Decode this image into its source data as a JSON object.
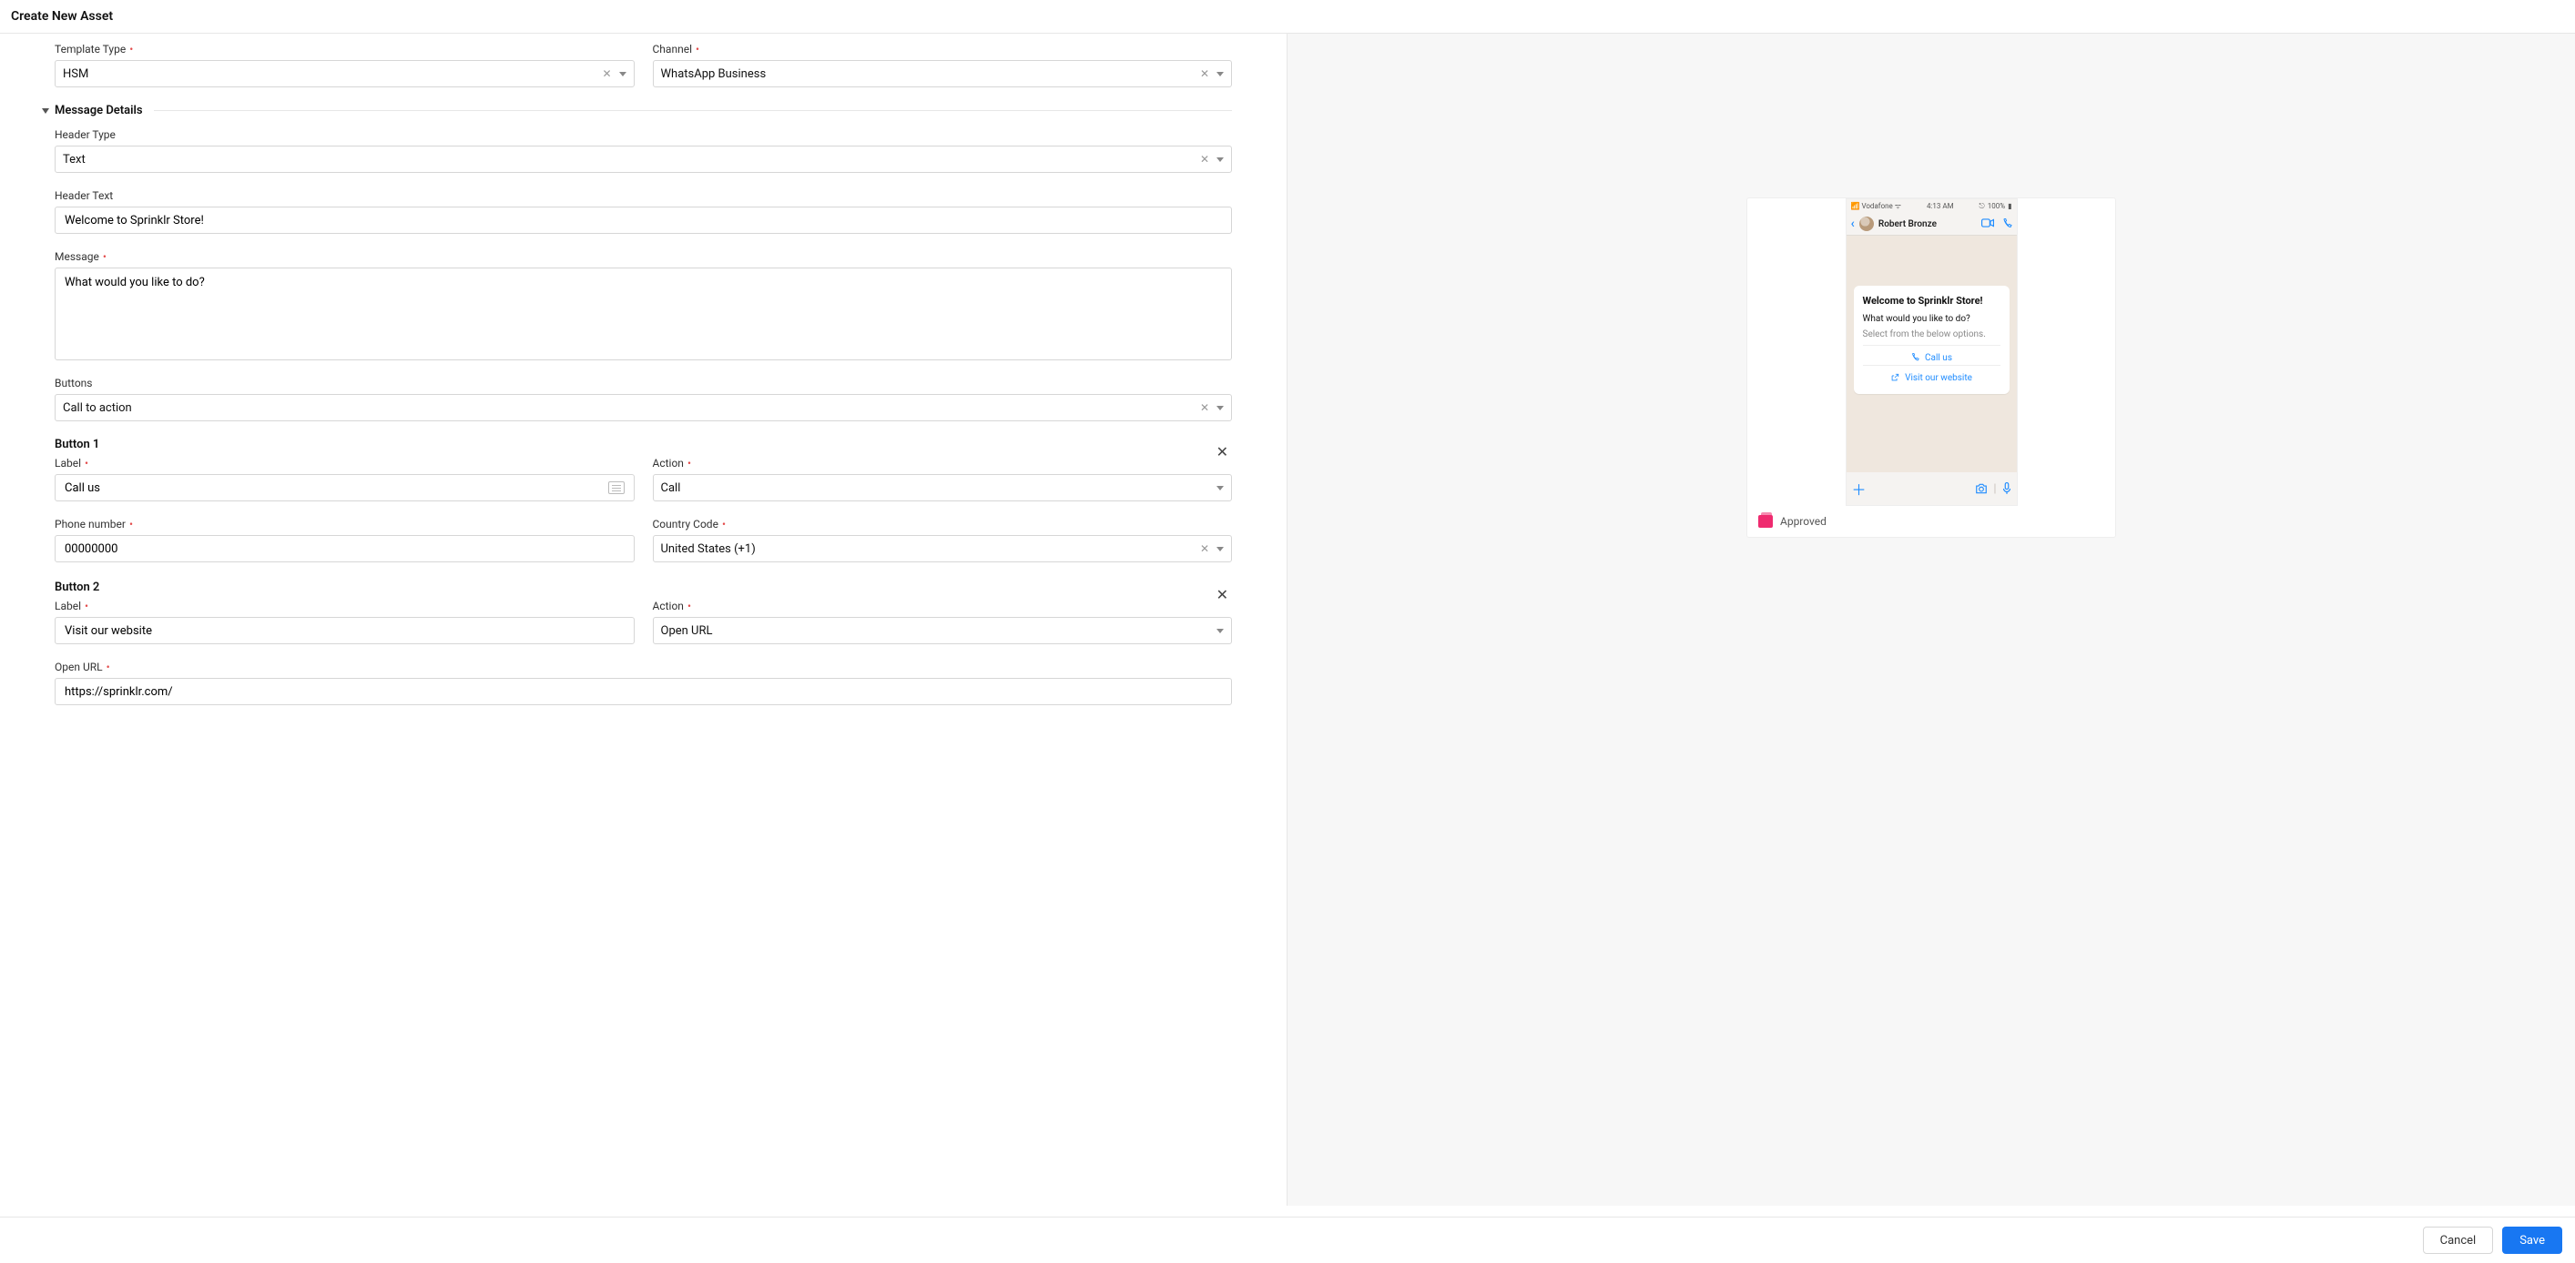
{
  "page": {
    "title": "Create New Asset"
  },
  "top": {
    "template_type_label": "Template Type",
    "template_type_value": "HSM",
    "channel_label": "Channel",
    "channel_value": "WhatsApp Business"
  },
  "section": {
    "message_details": "Message Details"
  },
  "msg": {
    "header_type_label": "Header Type",
    "header_type_value": "Text",
    "header_text_label": "Header Text",
    "header_text_value": "Welcome to Sprinklr Store!",
    "message_label": "Message",
    "message_value": "What would you like to do?",
    "buttons_label": "Buttons",
    "buttons_value": "Call to action"
  },
  "b1": {
    "title": "Button 1",
    "label_label": "Label",
    "label_value": "Call us",
    "action_label": "Action",
    "action_value": "Call",
    "phone_label": "Phone number",
    "phone_value": "00000000",
    "cc_label": "Country Code",
    "cc_value": "United States (+1)"
  },
  "b2": {
    "title": "Button 2",
    "label_label": "Label",
    "label_value": "Visit our website",
    "action_label": "Action",
    "action_value": "Open URL",
    "url_label": "Open URL",
    "url_value": "https://sprinklr.com/"
  },
  "footer": {
    "cancel": "Cancel",
    "save": "Save"
  },
  "preview": {
    "carrier": "Vodafone",
    "time": "4:13 AM",
    "battery": "100%",
    "contact": "Robert Bronze",
    "header": "Welcome to Sprinklr Store!",
    "body": "What would you like to do?",
    "sub": "Select from the below options.",
    "btn1": "Call us",
    "btn2": "Visit our website",
    "approved": "Approved"
  }
}
